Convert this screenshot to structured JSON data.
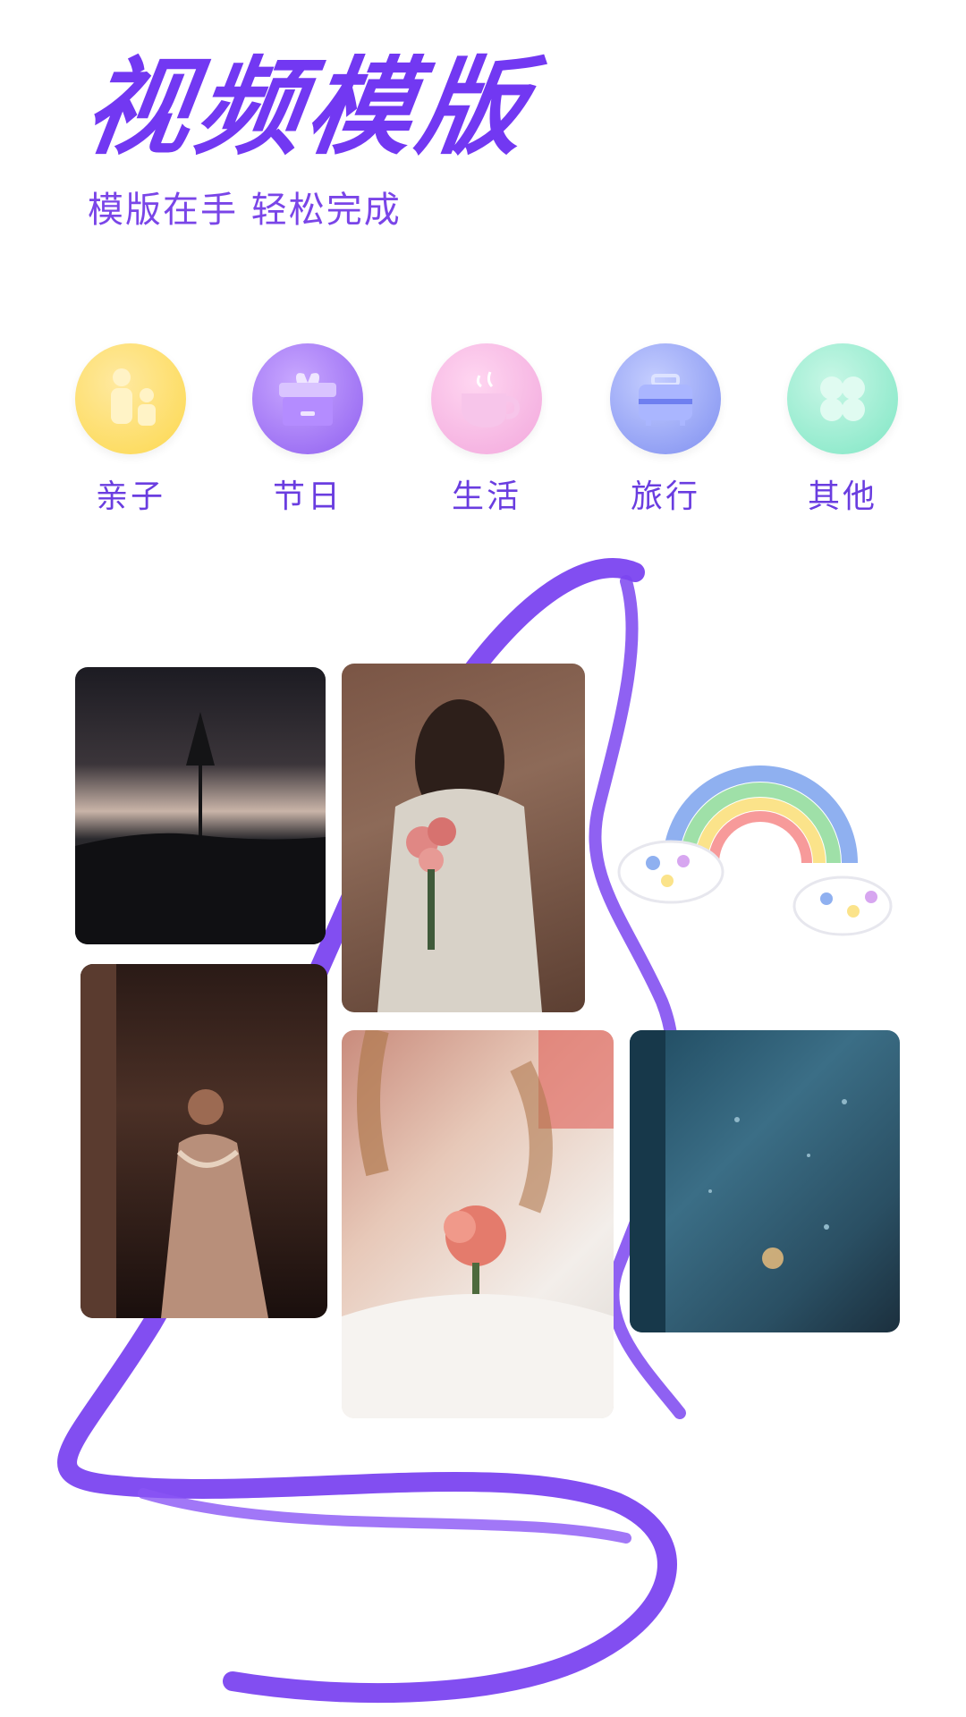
{
  "header": {
    "title": "视频模版",
    "subtitle": "模版在手 轻松完成"
  },
  "categories": [
    {
      "label": "亲子",
      "icon": "parent-child-icon",
      "color": "#fcd84e"
    },
    {
      "label": "节日",
      "icon": "gift-icon",
      "color": "#9a6df2"
    },
    {
      "label": "生活",
      "icon": "coffee-cup-icon",
      "color": "#f2a7dc"
    },
    {
      "label": "旅行",
      "icon": "suitcase-icon",
      "color": "#7f8ff0"
    },
    {
      "label": "其他",
      "icon": "clover-icon",
      "color": "#7fe6c4"
    }
  ],
  "colors": {
    "accent": "#7238f2",
    "brush": "#7b45f0"
  },
  "gallery": [
    {
      "name": "lone-tree-photo"
    },
    {
      "name": "rose-jacket-photo"
    },
    {
      "name": "dress-woman-photo"
    },
    {
      "name": "rose-chest-photo"
    },
    {
      "name": "rainy-window-photo"
    }
  ]
}
